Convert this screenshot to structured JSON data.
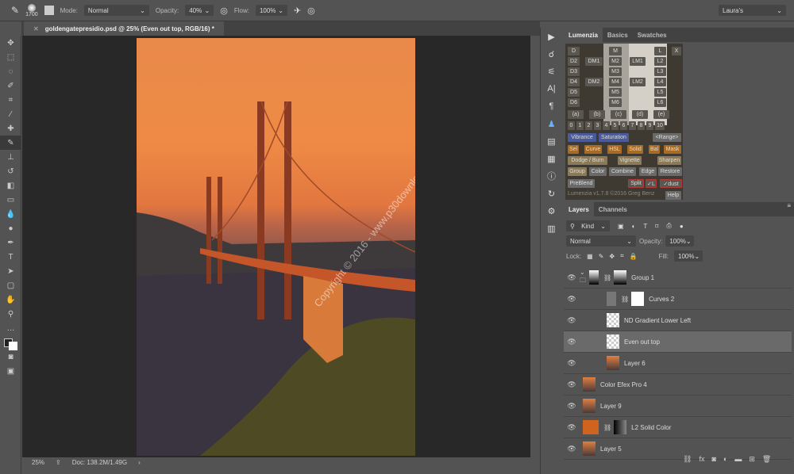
{
  "options": {
    "brush_size": "1700",
    "mode_label": "Mode:",
    "mode": "Normal",
    "opacity_label": "Opacity:",
    "opacity": "40%",
    "flow_label": "Flow:",
    "flow": "100%",
    "workspace": "Laura's"
  },
  "document": {
    "tab": "goldengatepresidio.psd @ 25% (Even out top, RGB/16) *",
    "zoom": "25%",
    "doc_size": "Doc: 138.2M/1.49G",
    "watermark": "Copyright © 2016 - www.p30download.com"
  },
  "lumenzia": {
    "tabs": [
      "Lumenzia",
      "Basics",
      "Swatches"
    ],
    "darks": [
      "D",
      "D2",
      "D3",
      "D4",
      "D5",
      "D6"
    ],
    "dm": [
      "DM1",
      "DM2"
    ],
    "mids": [
      "M",
      "M2",
      "M3",
      "M4",
      "M5",
      "M6"
    ],
    "lm": [
      "LM1",
      "LM2"
    ],
    "lights": [
      "L",
      "L2",
      "L3",
      "L4",
      "L5",
      "L6"
    ],
    "close": "X",
    "zones": [
      "(a)",
      "(b)",
      "(c)",
      "(d)",
      "(e)"
    ],
    "numbers": [
      "0",
      "1",
      "2",
      "3",
      "4",
      "5",
      "6",
      "7",
      "8",
      "9",
      "10"
    ],
    "vibrance": "Vibrance",
    "saturation": "Saturation",
    "range": "<Range>",
    "row1": [
      "Sel",
      "Curve",
      "HSL",
      "Solid",
      "Bal",
      "Mask"
    ],
    "row2": [
      "Dodge / Burn",
      "Vignette",
      "Sharpen"
    ],
    "row3": [
      "Group",
      "Color",
      "Combine",
      "Edge",
      "Restore"
    ],
    "row4": [
      "PreBlend",
      "Split",
      "✓L",
      "✓dust"
    ],
    "footer": "Lumenzia v1.7.8 ©2016 Greg Benz",
    "help": "Help"
  },
  "layers_panel": {
    "tabs": [
      "Layers",
      "Channels"
    ],
    "filter": "Kind",
    "blend": "Normal",
    "opacity_label": "Opacity:",
    "opacity": "100%",
    "lock_label": "Lock:",
    "fill_label": "Fill:",
    "fill": "100%",
    "layers": [
      {
        "name": "Group 1",
        "type": "group"
      },
      {
        "name": "Curves 2",
        "type": "adjustment"
      },
      {
        "name": "ND Gradient Lower Left",
        "type": "empty"
      },
      {
        "name": "Even out top",
        "type": "empty",
        "selected": true
      },
      {
        "name": "Layer 6",
        "type": "photo"
      },
      {
        "name": "Color Efex Pro 4",
        "type": "photo"
      },
      {
        "name": "Layer 9",
        "type": "photo"
      },
      {
        "name": "L2 Solid Color",
        "type": "fill",
        "color": "#d0641e"
      },
      {
        "name": "Layer 5",
        "type": "photo"
      }
    ]
  },
  "colors": {
    "selected_layer": "#6a6a6a",
    "solid_color": "#d0641e"
  }
}
